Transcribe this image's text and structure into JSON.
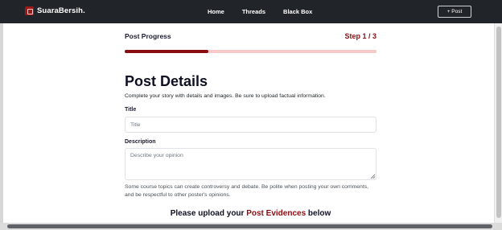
{
  "navbar": {
    "brand": "SuaraBersih.",
    "links": [
      "Home",
      "Threads",
      "Black Box"
    ],
    "post_button": "+ Post"
  },
  "progress": {
    "title": "Post Progress",
    "step": "Step 1 / 3",
    "fraction": 0.333,
    "accent_color": "#8b0d12",
    "track_color": "#f8c9c9"
  },
  "form": {
    "heading": "Post Details",
    "subtext": "Complete your story with details and images. Be sure to upload factual information.",
    "title_label": "Title",
    "title_placeholder": "Title",
    "description_label": "Description",
    "description_placeholder": "Describe your opinion",
    "helper_text": "Some course topics can create controversy and debate. Be polite when posting your own comments, and be respectful to other poster's opinions.",
    "upload_prefix": "Please upload your",
    "upload_highlight": "Post Evidences",
    "upload_suffix": "below"
  }
}
